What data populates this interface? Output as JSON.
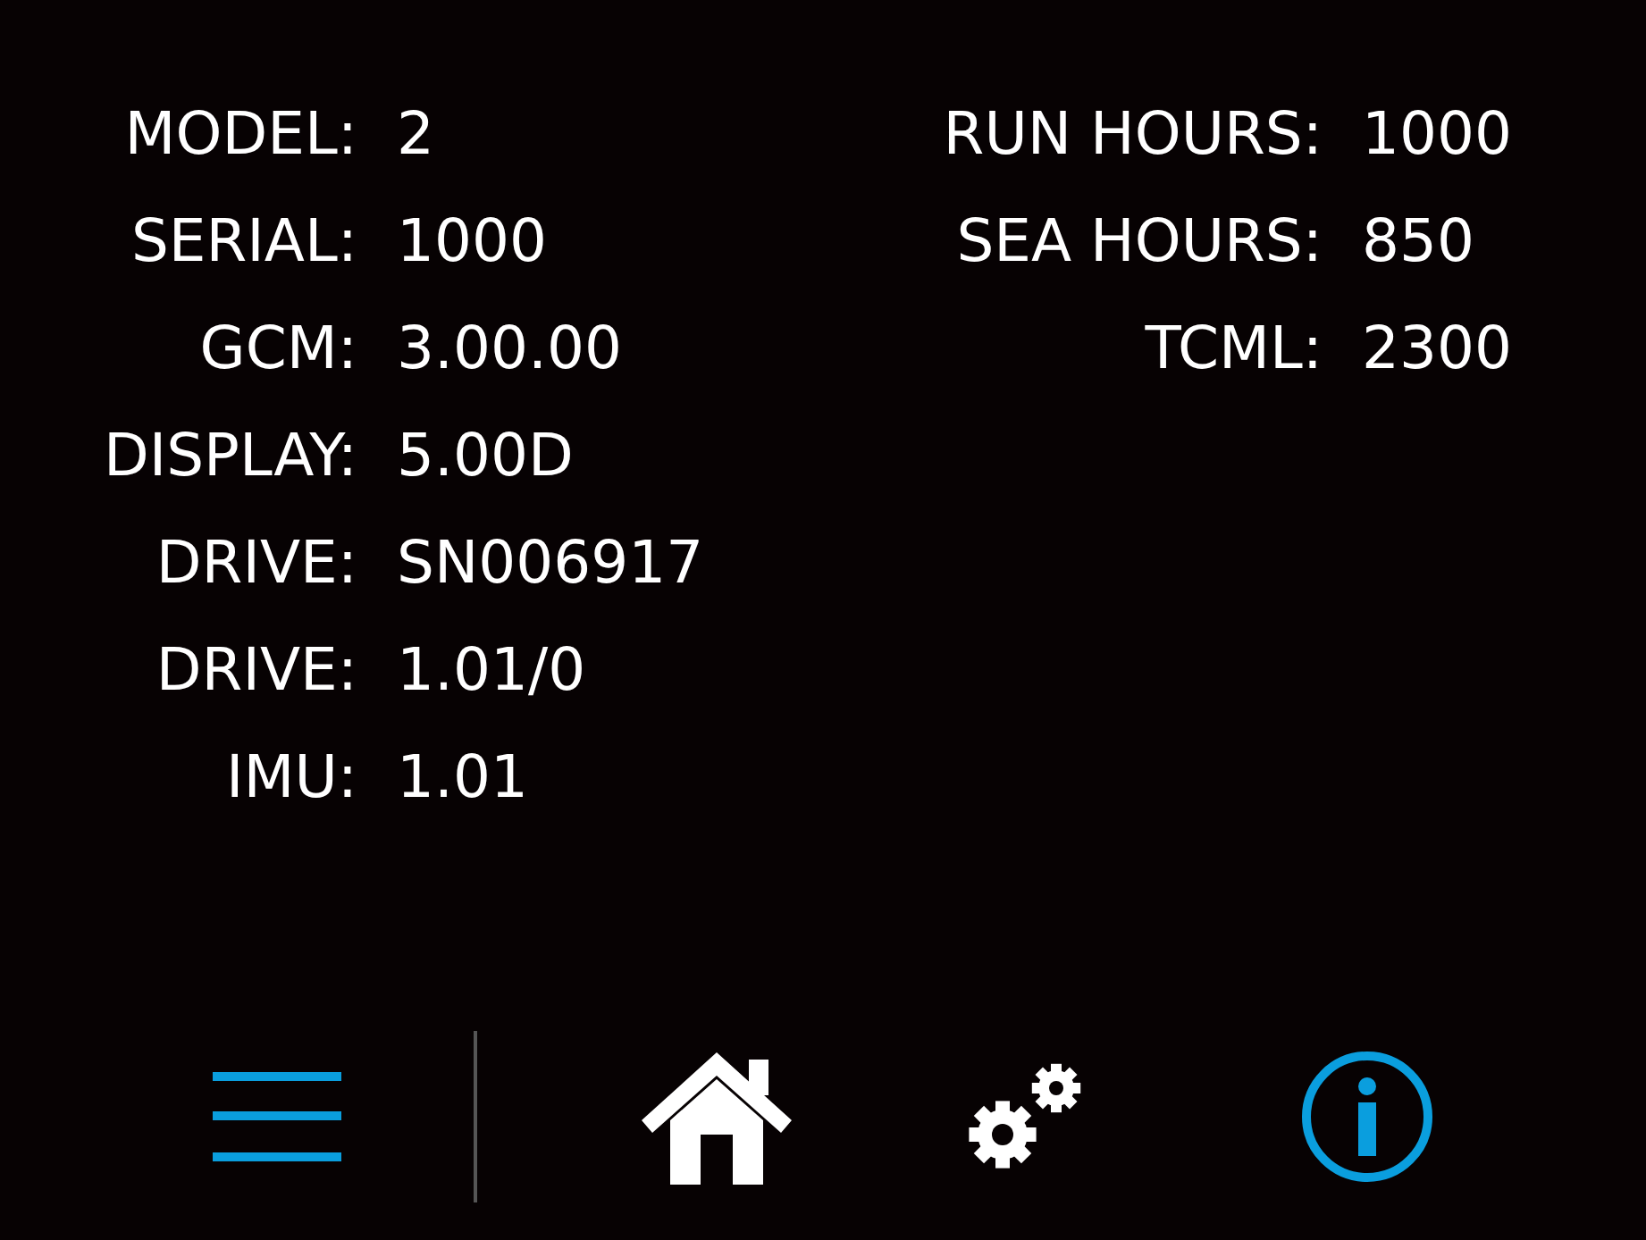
{
  "left_fields": [
    {
      "label": "MODEL:",
      "value": "2"
    },
    {
      "label": "SERIAL:",
      "value": "1000"
    },
    {
      "label": "GCM:",
      "value": "3.00.00"
    },
    {
      "label": "DISPLAY:",
      "value": "5.00D"
    },
    {
      "label": "DRIVE:",
      "value": "SN006917"
    },
    {
      "label": "DRIVE:",
      "value": "1.01/0"
    },
    {
      "label": "IMU:",
      "value": "1.01"
    }
  ],
  "right_fields": [
    {
      "label": "RUN HOURS:",
      "value": "1000"
    },
    {
      "label": "SEA HOURS:",
      "value": "850"
    },
    {
      "label": "TCML:",
      "value": "2300"
    }
  ],
  "nav_tabs": [
    {
      "kind": "home",
      "selected": false
    },
    {
      "kind": "settings",
      "selected": false
    },
    {
      "kind": "info",
      "selected": true
    }
  ]
}
